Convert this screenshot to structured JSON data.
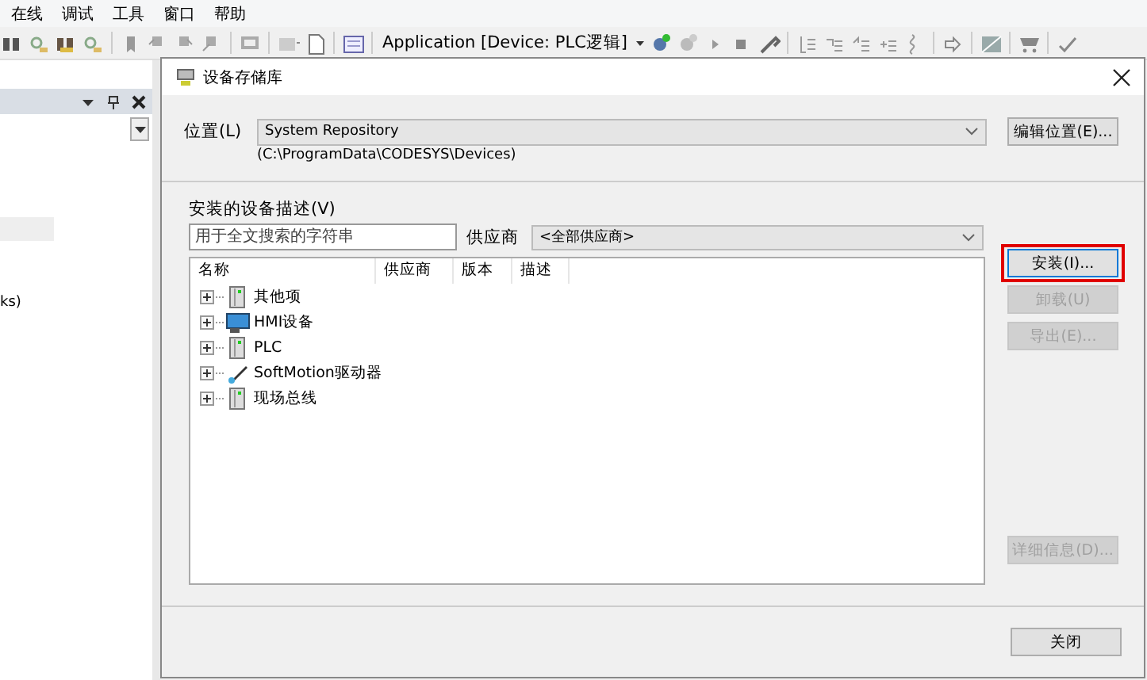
{
  "menu": [
    {
      "label": "在线"
    },
    {
      "label": "调试"
    },
    {
      "label": "工具"
    },
    {
      "label": "窗口"
    },
    {
      "label": "帮助"
    }
  ],
  "toolbar": {
    "application": "Application [Device: PLC逻辑]"
  },
  "left_panel": {
    "text_fragment": "ks)"
  },
  "dialog": {
    "title": "设备存储库",
    "location_label": "位置(L)",
    "location": "System Repository",
    "location_path": "(C:\\ProgramData\\CODESYS\\Devices)",
    "edit_button": "编辑位置(E)...",
    "section_label": "安装的设备描述(V)",
    "search": {
      "placeholder": "用于全文搜索的字符串"
    },
    "vendor_label": "供应商",
    "vendor": "<全部供应商>",
    "tree": {
      "columns": [
        "名称",
        "供应商",
        "版本",
        "描述"
      ],
      "items": [
        {
          "label": "其他项",
          "kind": "device",
          "expanded": false
        },
        {
          "label": "HMI设备",
          "kind": "hmi",
          "expanded": false
        },
        {
          "label": "PLC",
          "kind": "device",
          "expanded": false
        },
        {
          "label": "SoftMotion驱动器",
          "kind": "softmotion",
          "expanded": false
        },
        {
          "label": "现场总线",
          "kind": "device",
          "expanded": false
        }
      ]
    },
    "buttons": [
      {
        "label": "安装(I)...",
        "disabled": false,
        "highlighted": true
      },
      {
        "label": "卸载(U)",
        "disabled": true,
        "highlighted": false
      },
      {
        "label": "导出(E)...",
        "disabled": true,
        "highlighted": false
      },
      {
        "label": "详细信息(D)...",
        "disabled": true,
        "highlighted": false
      }
    ],
    "close_button": "关闭"
  }
}
